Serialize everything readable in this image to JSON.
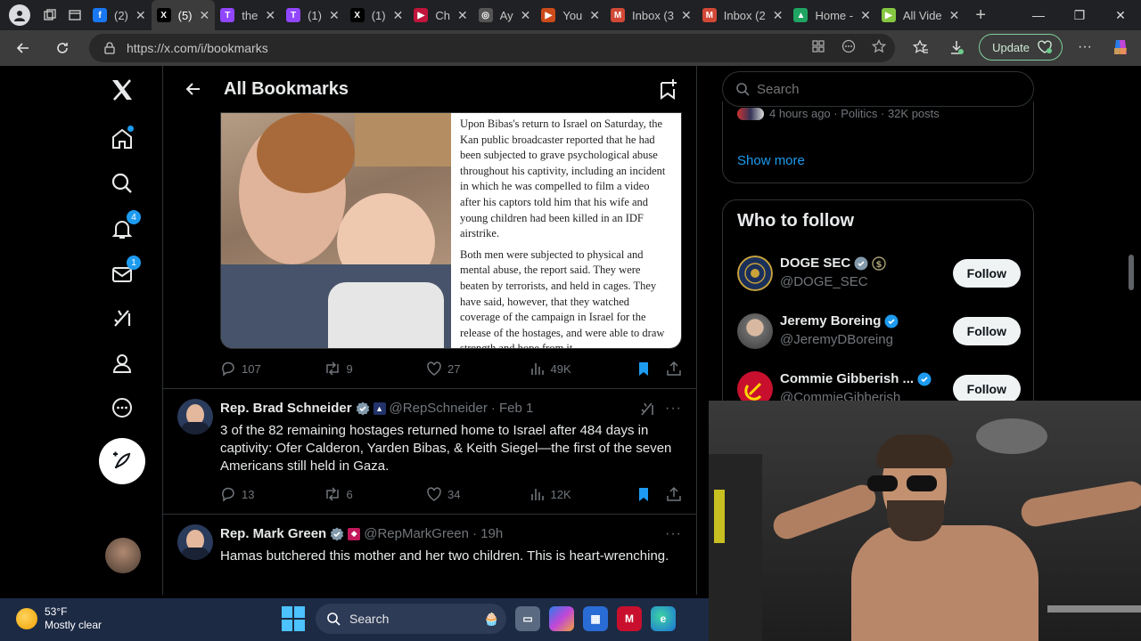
{
  "browser": {
    "tabs": [
      {
        "label": "(2)",
        "icon": "facebook-icon",
        "color": "#1877f2",
        "glyph": "f"
      },
      {
        "label": "(5)",
        "icon": "x-icon",
        "color": "#000000",
        "glyph": "X",
        "active": true
      },
      {
        "label": "the",
        "icon": "twitch-icon",
        "color": "#9146ff",
        "glyph": "T"
      },
      {
        "label": "(1)",
        "icon": "twitch-icon",
        "color": "#9146ff",
        "glyph": "T"
      },
      {
        "label": "(1)",
        "icon": "x-icon",
        "color": "#000000",
        "glyph": "X"
      },
      {
        "label": "Ch",
        "icon": "video-icon",
        "color": "#c0143c",
        "glyph": "▶"
      },
      {
        "label": "Ay",
        "icon": "openai-icon",
        "color": "#555555",
        "glyph": "◎"
      },
      {
        "label": "You",
        "icon": "youtube-icon",
        "color": "#cc4b1a",
        "glyph": "▶"
      },
      {
        "label": "Inbox (3",
        "icon": "gmail-icon",
        "color": "#d14836",
        "glyph": "M"
      },
      {
        "label": "Inbox (2",
        "icon": "gmail-icon",
        "color": "#d14836",
        "glyph": "M"
      },
      {
        "label": "Home -",
        "icon": "drive-icon",
        "color": "#1fa463",
        "glyph": "▲"
      },
      {
        "label": "All Vide",
        "icon": "rumble-icon",
        "color": "#85c742",
        "glyph": "▶"
      }
    ],
    "url": "https://x.com/i/bookmarks",
    "update_label": "Update"
  },
  "leftnav": {
    "notifications_badge": "4",
    "messages_badge": "1"
  },
  "header": {
    "title": "All Bookmarks"
  },
  "article": {
    "paragraph1": "Upon Bibas's return to Israel on Saturday, the Kan public broadcaster reported that he had been subjected to grave psychological abuse throughout his captivity, including an incident in which he was compelled to film a video after his captors told him that his wife and young children had been killed in an IDF airstrike.",
    "paragraph2": "Both men were subjected to physical and mental abuse, the report said. They were beaten by terrorists, and held in cages. They have said, however, that they watched coverage of the campaign in Israel for the release of the hostages, and were able to draw strength and hope from it."
  },
  "post1_stats": {
    "replies": "107",
    "reposts": "9",
    "likes": "27",
    "views": "49K"
  },
  "post2": {
    "name": "Rep. Brad Schneider",
    "handle": "@RepSchneider",
    "date": "· Feb 1",
    "text": "3 of the 82 remaining hostages returned home to Israel after 484 days in captivity: Ofer Calderon, Yarden Bibas, & Keith Siegel—the first of the seven Americans still held in Gaza.",
    "stats": {
      "replies": "13",
      "reposts": "6",
      "likes": "34",
      "views": "12K"
    }
  },
  "post3": {
    "name": "Rep. Mark Green",
    "handle": "@RepMarkGreen",
    "date": "· 19h",
    "text": "Hamas butchered this mother and her two children. This is heart-wrenching."
  },
  "search": {
    "placeholder": "Search"
  },
  "trends": {
    "meta": "4 hours ago · Politics · 32K posts",
    "show_more": "Show more"
  },
  "who_to_follow": {
    "title": "Who to follow",
    "follow_label": "Follow",
    "accounts": [
      {
        "name": "DOGE SEC",
        "handle": "@DOGE_SEC"
      },
      {
        "name": "Jeremy Boreing",
        "handle": "@JeremyDBoreing"
      },
      {
        "name": "Commie Gibberish ...",
        "handle": "@CommieGibberish"
      }
    ]
  },
  "taskbar": {
    "temperature": "53°F",
    "condition": "Mostly clear",
    "search_label": "Search"
  },
  "colors": {
    "accent": "#1d9bf0",
    "background": "#000000",
    "follow_button": "#eff3f4"
  }
}
